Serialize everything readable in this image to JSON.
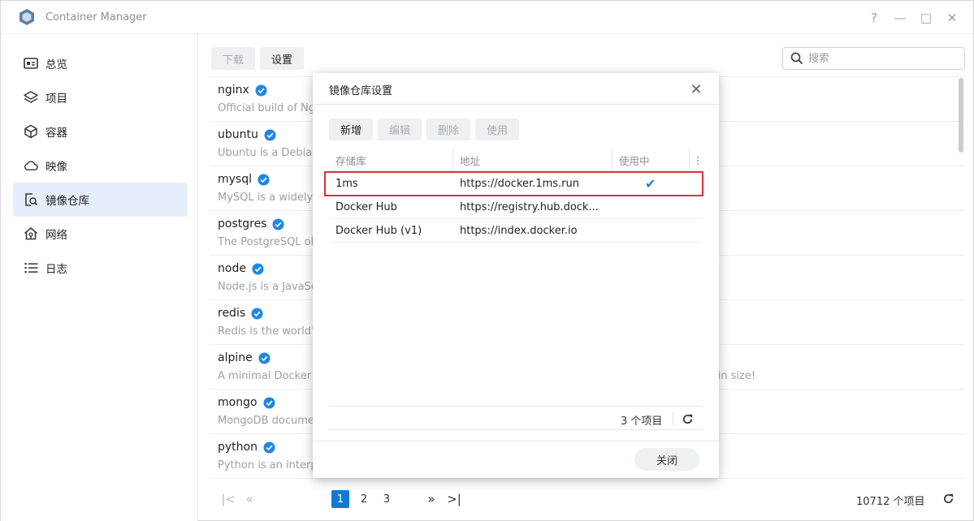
{
  "window": {
    "title": "Container Manager",
    "controls": [
      "?",
      "—",
      "□",
      "✕"
    ]
  },
  "sidebar": {
    "items": [
      {
        "label": "总览",
        "icon": "overview-icon"
      },
      {
        "label": "项目",
        "icon": "layers-icon"
      },
      {
        "label": "容器",
        "icon": "cube-icon"
      },
      {
        "label": "映像",
        "icon": "cloud-icon"
      },
      {
        "label": "镜像仓库",
        "icon": "registry-search-icon",
        "active": true
      },
      {
        "label": "网络",
        "icon": "network-home-icon"
      },
      {
        "label": "日志",
        "icon": "list-icon"
      }
    ]
  },
  "toolbar": {
    "download_label": "下载",
    "settings_label": "设置"
  },
  "search": {
    "placeholder": "搜索"
  },
  "images": [
    {
      "name": "nginx",
      "desc": "Official build of Nginx."
    },
    {
      "name": "ubuntu",
      "desc": "Ubuntu is a Debian-based Linux operating system based on free software."
    },
    {
      "name": "mysql",
      "desc": "MySQL is a widely used, open-source relational database management system (RDBMS)."
    },
    {
      "name": "postgres",
      "desc": "The PostgreSQL object-relational database system provides reliability and data integrity."
    },
    {
      "name": "node",
      "desc": "Node.js is a JavaScript-based platform for server-side and networking applications."
    },
    {
      "name": "redis",
      "desc": "Redis is the world’s fastest data platform for caching, vector search, and NoSQL databases."
    },
    {
      "name": "alpine",
      "desc": "A minimal Docker image based on Alpine Linux with a complete package index and only 5 MB in size!"
    },
    {
      "name": "mongo",
      "desc": "MongoDB document databases provide high availability and easy scalability."
    },
    {
      "name": "python",
      "desc": "Python is an interpreted, interactive, object-oriented, open-source programming language."
    }
  ],
  "pager": {
    "first": "|<",
    "prev": "«",
    "pages": [
      "1",
      "2",
      "3"
    ],
    "active_page": "1",
    "next": "»",
    "last": ">|",
    "total": "10712 个项目"
  },
  "dialog": {
    "title": "镜像仓库设置",
    "buttons": {
      "add": "新增",
      "edit": "编辑",
      "delete": "删除",
      "use": "使用"
    },
    "columns": {
      "registry": "存储库",
      "address": "地址",
      "in_use": "使用中"
    },
    "rows": [
      {
        "registry": "1ms",
        "address": "https://docker.1ms.run",
        "in_use": "✔"
      },
      {
        "registry": "Docker Hub",
        "address": "https://registry.hub.dock...",
        "in_use": ""
      },
      {
        "registry": "Docker Hub (v1)",
        "address": "https://index.docker.io",
        "in_use": ""
      }
    ],
    "count": "3 个项目",
    "close_label": "关闭"
  },
  "colors": {
    "accent": "#0a7ad6",
    "highlight_border": "#d9343c",
    "verified": "#1e88e5",
    "active_nav_bg": "#e6eefb"
  }
}
